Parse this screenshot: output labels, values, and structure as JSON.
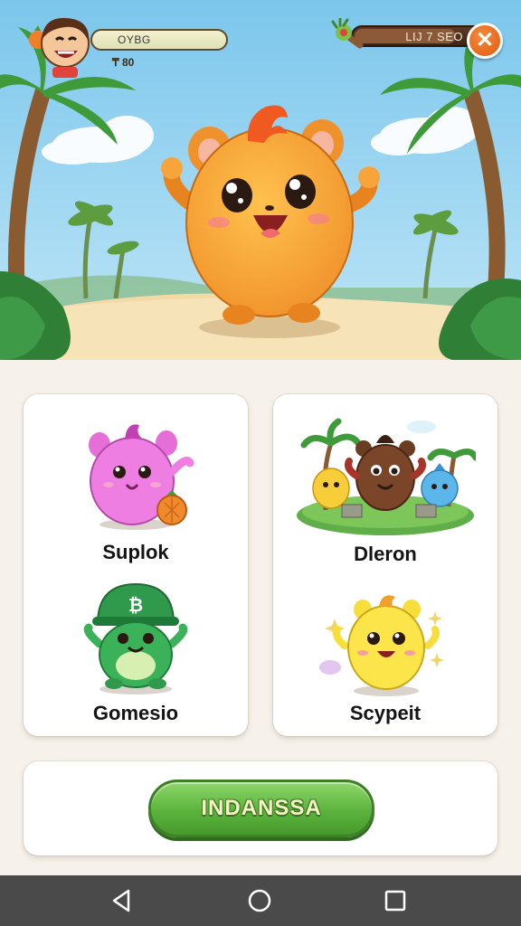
{
  "player": {
    "name": "OYBG",
    "coins": "₸ 80"
  },
  "resource": {
    "value": "LIJ 7 SEO",
    "level": 0.78
  },
  "cards": {
    "left": [
      {
        "label": "Suplok"
      },
      {
        "label": "Gomesio"
      }
    ],
    "right": [
      {
        "label": "Dleron"
      },
      {
        "label": "Scypeit"
      }
    ]
  },
  "action": {
    "label": "INDANSSA"
  },
  "colors": {
    "accent_orange": "#f0922b",
    "button_green": "#5bb33c",
    "sky_blue": "#8fcfee"
  },
  "icons": {
    "close": "close-icon",
    "resource": "fruit-icon",
    "nav": [
      "back-icon",
      "home-icon",
      "recents-icon"
    ]
  }
}
